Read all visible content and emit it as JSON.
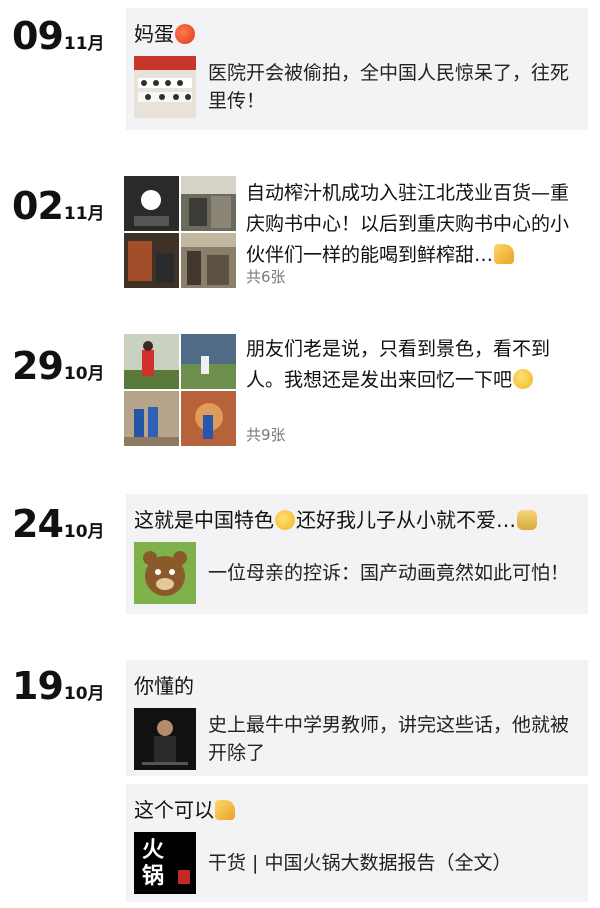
{
  "timeline": [
    {
      "day": "09",
      "month": "11月",
      "post": {
        "text": "妈蛋",
        "emoji": "angry-face",
        "link_text": "医院开会被偷拍，全中国人民惊呆了，往死里传！"
      }
    },
    {
      "day": "02",
      "month": "11月",
      "post": {
        "text": "自动榨汁机成功入驻江北茂业百货—重庆购书中心！以后到重庆购书中心的小伙伴们一样的能喝到鲜榨甜…",
        "emoji": "thumbs-up",
        "count": "共6张"
      }
    },
    {
      "day": "29",
      "month": "10月",
      "post": {
        "text": "朋友们老是说，只看到景色，看不到人。我想还是发出来回忆一下吧",
        "emoji": "winking-face",
        "count": "共9张"
      }
    },
    {
      "day": "24",
      "month": "10月",
      "post": {
        "text_a": "这就是中国特色",
        "emoji_a": "smirking-face",
        "text_b": "还好我儿子从小就不爱…",
        "emoji_b": "money-bag",
        "link_text": "一位母亲的控诉：国产动画竟然如此可怕！"
      }
    },
    {
      "day": "19",
      "month": "10月",
      "post": {
        "text": "你懂的",
        "link_text": "史上最牛中学男教师，讲完这些话，他就被开除了"
      },
      "post2": {
        "text": "这个可以",
        "emoji": "thumbs-up",
        "link_text": "干货 | 中国火锅大数据报告（全文）",
        "thumb_text": "火锅"
      }
    }
  ]
}
